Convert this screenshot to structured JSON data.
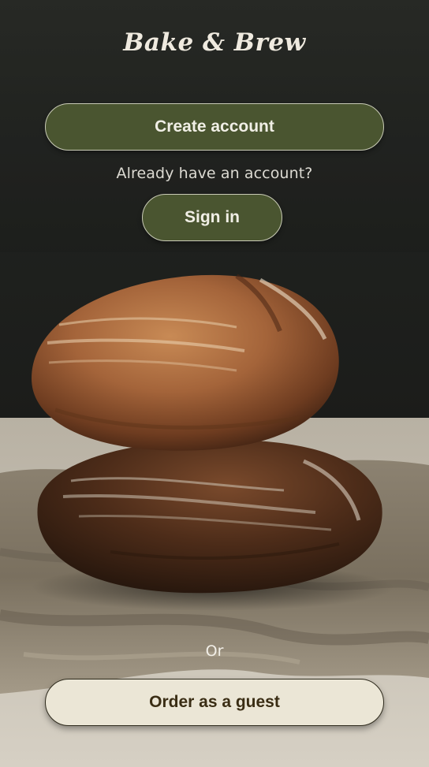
{
  "app": {
    "title": "Bake & Brew"
  },
  "auth": {
    "create_account_label": "Create account",
    "already_have_account_text": "Already have an account?",
    "sign_in_label": "Sign in"
  },
  "guest": {
    "or_text": "Or",
    "order_as_guest_label": "Order as a guest"
  },
  "background": {
    "image_subject": "two-stacked-sourdough-loaves-on-linen-cloth"
  },
  "colors": {
    "primary_button": "#4a5530",
    "primary_button_text": "#f1efe6",
    "guest_button": "#ebe6d6",
    "guest_button_text": "#3a2d14",
    "background_dark": "#242622",
    "linen": "#8a7f6f"
  }
}
